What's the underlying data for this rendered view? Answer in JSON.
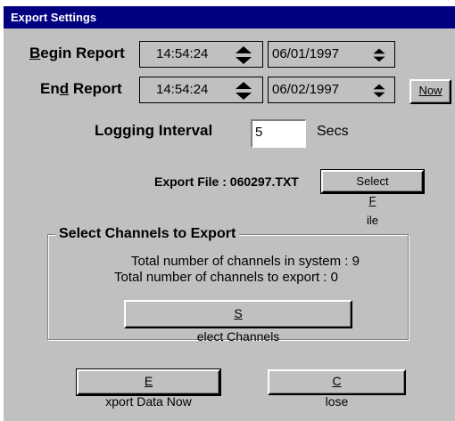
{
  "window": {
    "title": "Export Settings"
  },
  "begin_report": {
    "label_prefix": "B",
    "label_rest": "egin Report",
    "time": "14:54:24",
    "date": "06/01/1997"
  },
  "end_report": {
    "label_pre": "En",
    "label_u": "d",
    "label_rest": " Report",
    "time": "14:54:24",
    "date": "06/02/1997",
    "now_button": "Now"
  },
  "logging": {
    "label": "Logging Interval",
    "value": "5",
    "unit": "Secs"
  },
  "export_file": {
    "label": "Export File : 060297.TXT",
    "button_pre": "Select ",
    "button_u": "F",
    "button_rest": "ile"
  },
  "channels": {
    "group_title": "Select Channels to Export",
    "total_system": "Total number of channels in system :  9",
    "total_export": "Total number of channels to export : 0",
    "button_u": "S",
    "button_rest": "elect Channels"
  },
  "footer": {
    "export_u": "E",
    "export_rest": "xport Data Now",
    "close_u": "C",
    "close_rest": "lose"
  }
}
